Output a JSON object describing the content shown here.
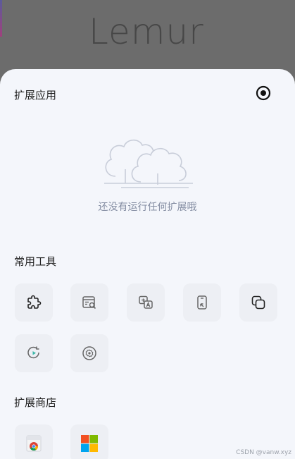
{
  "header": {
    "logo_text": "Lemur"
  },
  "extensions": {
    "title": "扩展应用",
    "empty_text": "还没有运行任何扩展哦"
  },
  "tools": {
    "title": "常用工具",
    "items": [
      {
        "icon": "puzzle-icon"
      },
      {
        "icon": "window-search-icon"
      },
      {
        "icon": "translate-icon"
      },
      {
        "icon": "phone-arrow-icon"
      },
      {
        "icon": "copy-icon"
      },
      {
        "icon": "refresh-play-icon"
      },
      {
        "icon": "settings-gear-icon"
      }
    ]
  },
  "store": {
    "title": "扩展商店",
    "items": [
      {
        "icon": "chrome-store-icon"
      },
      {
        "icon": "microsoft-store-icon"
      }
    ]
  },
  "watermark": "CSDN @vanw.xyz",
  "colors": {
    "sheet_bg": "#f4f6fb",
    "tile_bg": "#edeff4",
    "empty_text": "#858ea3",
    "ms_red": "#f25022",
    "ms_green": "#7fba00",
    "ms_blue": "#00a4ef",
    "ms_yellow": "#ffb900"
  }
}
